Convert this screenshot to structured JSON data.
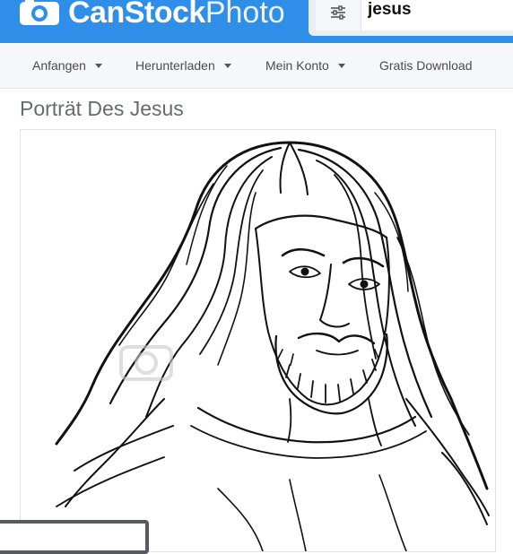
{
  "logo": {
    "text_bold": "CanStock",
    "text_light": "Photo",
    "icon": "camera-logo-icon"
  },
  "search": {
    "query": "jesus",
    "filter_icon": "sliders-icon"
  },
  "nav": {
    "items": [
      {
        "label": "Anfangen",
        "dropdown": true
      },
      {
        "label": "Herunterladen",
        "dropdown": true
      },
      {
        "label": "Mein Konto",
        "dropdown": true
      },
      {
        "label": "Gratis Download",
        "dropdown": false
      }
    ]
  },
  "page": {
    "title": "Porträt Des Jesus"
  },
  "image": {
    "subject": "jesus-portrait-sketch",
    "watermark_icon": "camera-watermark-icon"
  },
  "colors": {
    "brand": "#2f8ee8",
    "nav_bg": "#f6f7f9",
    "title": "#666b70"
  }
}
